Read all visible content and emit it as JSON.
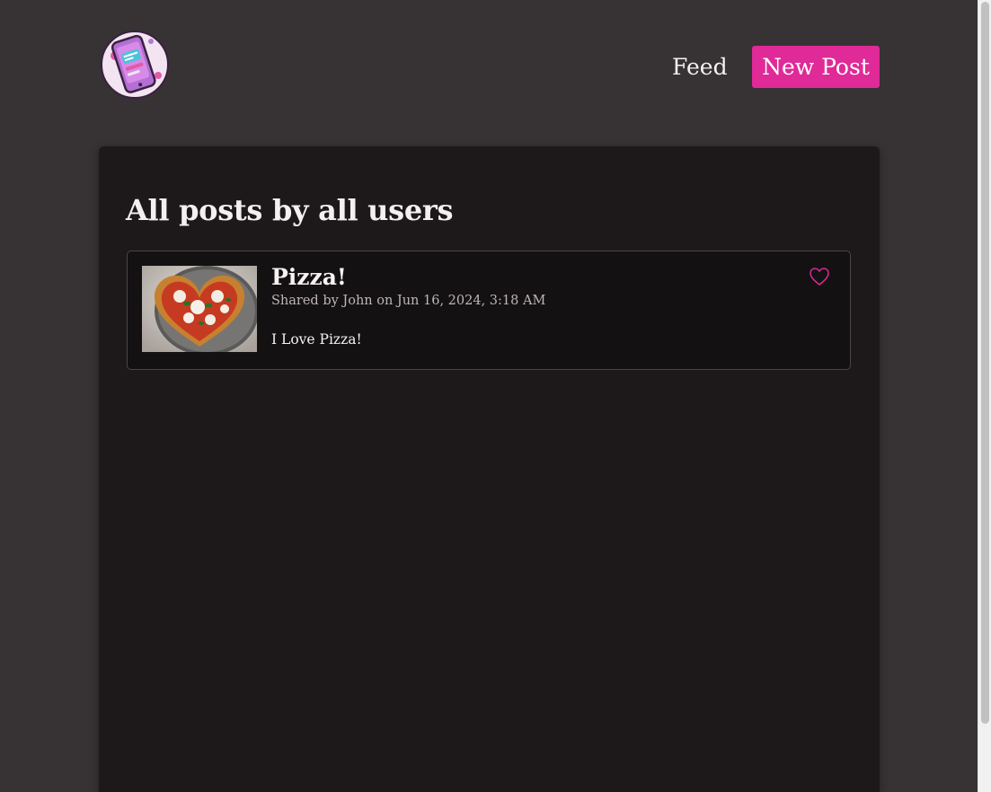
{
  "nav": {
    "feed_label": "Feed",
    "new_post_label": "New Post"
  },
  "colors": {
    "accent": "#df2a97",
    "background": "#373234",
    "panel": "#1d191b"
  },
  "page": {
    "title": "All posts by all users"
  },
  "posts": [
    {
      "title": "Pizza!",
      "meta": "Shared by John on Jun 16, 2024, 3:18 AM",
      "body": "I Love Pizza!",
      "liked": false,
      "thumb_icon": "heart-pizza-image"
    }
  ],
  "icons": {
    "logo": "phone-logo-icon",
    "like": "heart-icon"
  }
}
